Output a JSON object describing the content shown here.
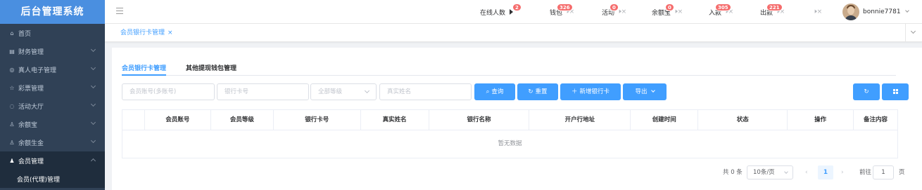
{
  "app": {
    "title": "后台管理系统"
  },
  "sidebar": {
    "items": [
      {
        "label": "首页",
        "icon": "home-icon",
        "glyph": "⌂"
      },
      {
        "label": "财务管理",
        "icon": "finance-icon",
        "glyph": "▤"
      },
      {
        "label": "真人电子管理",
        "icon": "live-casino-icon",
        "glyph": "◎"
      },
      {
        "label": "彩票管理",
        "icon": "star-icon",
        "glyph": "☆"
      },
      {
        "label": "活动大厅",
        "icon": "activity-icon",
        "glyph": "◌"
      },
      {
        "label": "余额宝",
        "icon": "user-icon",
        "glyph": "♙"
      },
      {
        "label": "余额生金",
        "icon": "user-icon",
        "glyph": "♙"
      },
      {
        "label": "会员管理",
        "icon": "member-icon",
        "glyph": "♟"
      }
    ],
    "sub_item": "会员(代理)管理"
  },
  "header": {
    "notifications": [
      {
        "label": "在线人数",
        "badge": "2"
      },
      {
        "label": "钱包",
        "badge": "326"
      },
      {
        "label": "活动",
        "badge": "0"
      },
      {
        "label": "余额宝",
        "badge": "0"
      },
      {
        "label": "入款",
        "badge": "305"
      },
      {
        "label": "出款",
        "badge": "221"
      }
    ],
    "username": "bonnie7781"
  },
  "tabs": {
    "active": "会员银行卡管理",
    "close": "×"
  },
  "subtabs": [
    "会员银行卡管理",
    "其他提现钱包管理"
  ],
  "filters": {
    "account_placeholder": "会员账号(多账号)",
    "card_placeholder": "银行卡号",
    "level_placeholder": "全部等级",
    "name_placeholder": "真实姓名"
  },
  "buttons": {
    "query": "查询",
    "reset": "重置",
    "add": "新增银行卡",
    "export": "导出"
  },
  "table": {
    "columns": [
      "会员账号",
      "会员等级",
      "银行卡号",
      "真实姓名",
      "银行名称",
      "开户行地址",
      "创建时间",
      "状态",
      "操作",
      "备注内容"
    ],
    "empty_text": "暂无数据"
  },
  "pagination": {
    "total": "共 0 条",
    "page_size": "10条/页",
    "current": "1",
    "goto_label": "前往",
    "goto_value": "1",
    "page_suffix": "页"
  },
  "colors": {
    "primary": "#409eff",
    "sidebar": "#304156",
    "logo": "#4a8fe0",
    "badge": "#f56c6c"
  }
}
